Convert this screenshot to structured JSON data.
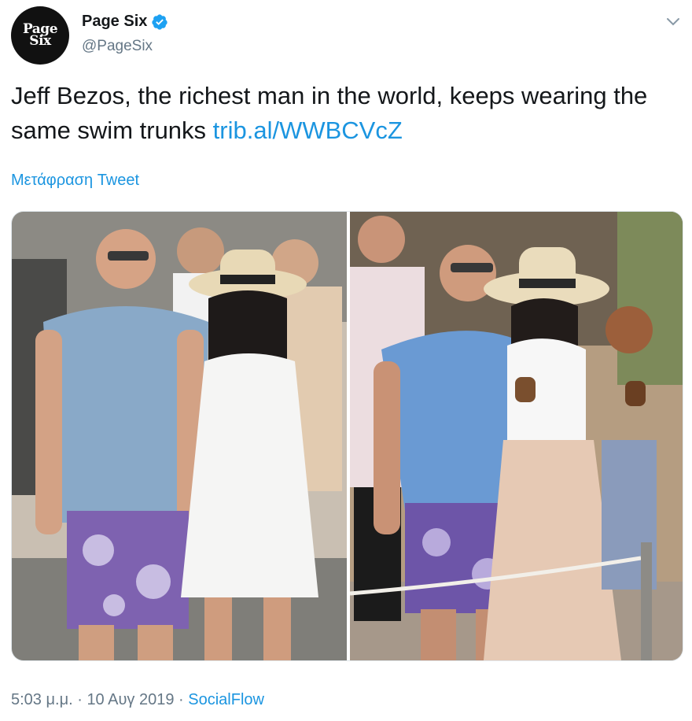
{
  "account": {
    "avatar_text": "Page\nSix",
    "display_name": "Page Six",
    "handle": "@PageSix",
    "verified_icon": "verified-badge-icon"
  },
  "tweet": {
    "text": "Jeff Bezos, the richest man in the world, keeps wearing the same swim trunks ",
    "link": "trib.al/WWBCVcZ",
    "translate_label": "Μετάφραση Tweet"
  },
  "meta": {
    "time": "5:03 μ.μ.",
    "separator1": " · ",
    "date": "10 Αυγ 2019",
    "separator2": " · ",
    "source": "SocialFlow"
  },
  "colors": {
    "link": "#1b95e0",
    "secondary_text": "#657786",
    "primary_text": "#14171a"
  }
}
